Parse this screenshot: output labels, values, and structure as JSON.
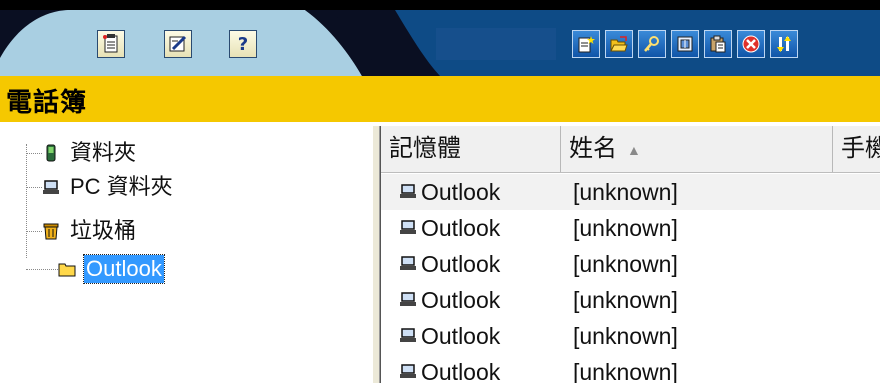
{
  "toolbar": {
    "left_buttons": [
      {
        "name": "contact-card-icon"
      },
      {
        "name": "edit-note-icon"
      },
      {
        "name": "help-icon",
        "glyph": "?"
      }
    ],
    "right_buttons": [
      {
        "name": "new-item-icon"
      },
      {
        "name": "open-folder-icon"
      },
      {
        "name": "properties-icon"
      },
      {
        "name": "copy-icon"
      },
      {
        "name": "paste-icon"
      },
      {
        "name": "delete-icon"
      },
      {
        "name": "sort-icon"
      }
    ]
  },
  "title": "電話簿",
  "tree": {
    "items": [
      {
        "label": "資料夾",
        "icon": "phone-icon"
      },
      {
        "label": "PC 資料夾",
        "icon": "computer-icon"
      },
      {
        "label": "垃圾桶",
        "icon": "trash-icon"
      },
      {
        "label": "Outlook",
        "icon": "folder-icon",
        "selected": true
      }
    ]
  },
  "list": {
    "columns": [
      "記憶體",
      "姓名",
      "手機"
    ],
    "sort_indicator": "▲",
    "rows": [
      {
        "memory": "Outlook",
        "name": "[unknown]"
      },
      {
        "memory": "Outlook",
        "name": "[unknown]"
      },
      {
        "memory": "Outlook",
        "name": "[unknown]"
      },
      {
        "memory": "Outlook",
        "name": "[unknown]"
      },
      {
        "memory": "Outlook",
        "name": "[unknown]"
      },
      {
        "memory": "Outlook",
        "name": "[unknown]"
      }
    ]
  },
  "colors": {
    "title_bar": "#f5c800",
    "toolbar_dark": "#0a0f22",
    "toolbar_light": "#a9cfe2",
    "toolbar_blue": "#0e4b86",
    "selection": "#3399ff"
  }
}
